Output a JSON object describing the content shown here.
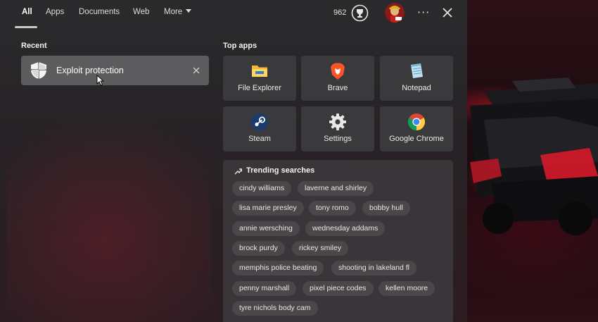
{
  "tabs": [
    {
      "label": "All",
      "active": true
    },
    {
      "label": "Apps"
    },
    {
      "label": "Documents"
    },
    {
      "label": "Web"
    },
    {
      "label": "More"
    }
  ],
  "header": {
    "points": "962",
    "reward_icon": "trophy-medal-icon",
    "avatar": "user-avatar"
  },
  "recent": {
    "title": "Recent",
    "items": [
      {
        "label": "Exploit protection",
        "icon": "shield-icon"
      }
    ]
  },
  "top_apps": {
    "title": "Top apps",
    "apps": [
      {
        "label": "File Explorer",
        "icon": "folder-icon"
      },
      {
        "label": "Brave",
        "icon": "brave-lion-icon"
      },
      {
        "label": "Notepad",
        "icon": "notepad-icon"
      },
      {
        "label": "Steam",
        "icon": "steam-icon"
      },
      {
        "label": "Settings",
        "icon": "gear-icon"
      },
      {
        "label": "Google Chrome",
        "icon": "chrome-icon"
      }
    ]
  },
  "trending": {
    "title": "Trending searches",
    "chips": [
      "cindy williams",
      "laverne and shirley",
      "lisa marie presley",
      "tony romo",
      "bobby hull",
      "annie wersching",
      "wednesday addams",
      "brock purdy",
      "rickey smiley",
      "memphis police beating",
      "shooting in lakeland fl",
      "penny marshall",
      "pixel piece codes",
      "kellen moore",
      "tyre nichols body cam"
    ]
  },
  "colors": {
    "panel": "#2a2a2c",
    "tile": "#3a393c",
    "recent_item": "#5c5b5d",
    "chip": "#4a4649",
    "wallpaper_accent": "#e01428"
  }
}
